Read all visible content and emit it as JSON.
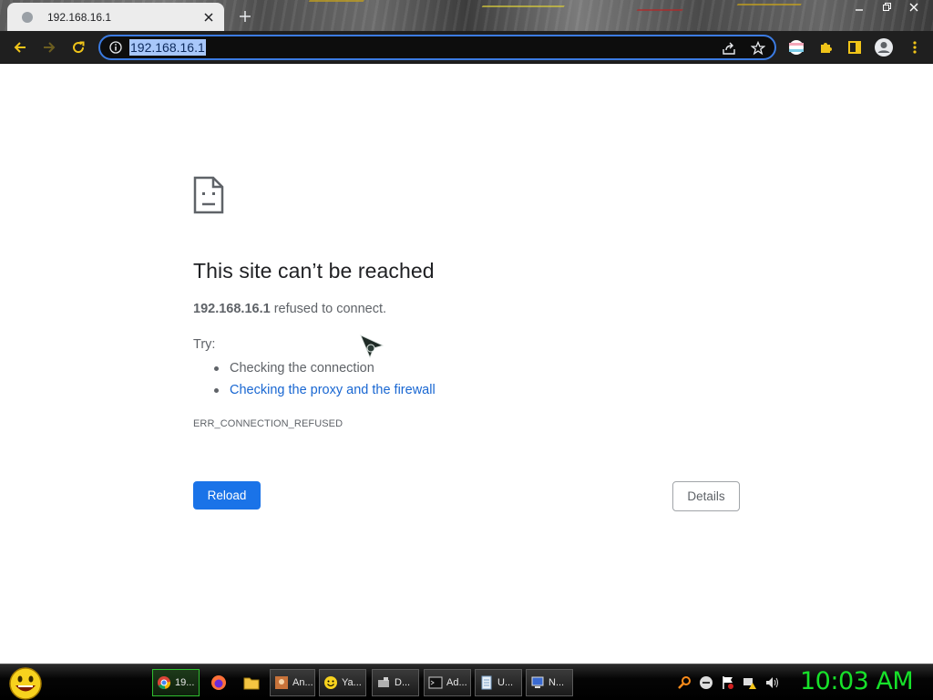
{
  "tab": {
    "title": "192.168.16.1",
    "favicon": "page-icon",
    "close_icon": "close-icon"
  },
  "toolbar": {
    "back_icon": "arrow-left-icon",
    "forward_icon": "arrow-right-icon",
    "reload_icon": "reload-icon",
    "url": "192.168.16.1",
    "info_icon": "info-icon",
    "share_icon": "share-icon",
    "bookmark_icon": "star-icon",
    "extensions": [
      "profile-flag-icon",
      "puzzle-icon",
      "sidepanel-icon",
      "avatar-icon",
      "menu-dots-icon"
    ]
  },
  "page": {
    "heading": "This site can’t be reached",
    "host": "192.168.16.1",
    "message": " refused to connect.",
    "try_label": "Try:",
    "suggestions": [
      {
        "text": "Checking the connection",
        "is_link": false
      },
      {
        "text": "Checking the proxy and the firewall",
        "is_link": true
      }
    ],
    "error_code": "ERR_CONNECTION_REFUSED",
    "reload_label": "Reload",
    "details_label": "Details",
    "accent_color": "#1a73e8",
    "link_color": "#1967d2"
  },
  "taskbar": {
    "tasks": [
      {
        "label": "19...",
        "icon": "chrome-icon",
        "active": true
      },
      {
        "label": "An...",
        "icon": "app-icon",
        "active": false
      },
      {
        "label": "Ya...",
        "icon": "smiley-icon",
        "active": false
      },
      {
        "label": "D...",
        "icon": "device-icon",
        "active": false
      },
      {
        "label": "Ad...",
        "icon": "terminal-icon",
        "active": false
      },
      {
        "label": "U...",
        "icon": "notepad-icon",
        "active": false
      },
      {
        "label": "N...",
        "icon": "network-icon",
        "active": false
      }
    ],
    "quick_launch": [
      "firefox-icon",
      "folder-icon"
    ],
    "tray": [
      "search-icon",
      "minus-circle-icon",
      "flag-icon",
      "network-warning-icon",
      "volume-icon"
    ],
    "clock": "10:03 AM",
    "clock_color": "#17e12a"
  }
}
